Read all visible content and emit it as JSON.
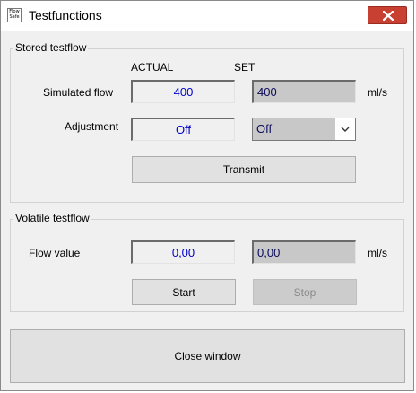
{
  "window": {
    "title": "Testfunctions",
    "icon_text_line1": "Flow",
    "icon_text_line2": "Safe"
  },
  "stored": {
    "legend": "Stored testflow",
    "actual_header": "ACTUAL",
    "set_header": "SET",
    "simulated_flow_label": "Simulated flow",
    "simulated_flow_actual": "400",
    "simulated_flow_set": "400",
    "simulated_flow_unit": "ml/s",
    "adjustment_label": "Adjustment",
    "adjustment_actual": "Off",
    "adjustment_set": "Off",
    "transmit_label": "Transmit"
  },
  "volatile": {
    "legend": "Volatile testflow",
    "flow_value_label": "Flow value",
    "flow_value_actual": "0,00",
    "flow_value_set": "0,00",
    "flow_value_unit": "ml/s",
    "start_label": "Start",
    "stop_label": "Stop"
  },
  "close_window_label": "Close window",
  "colors": {
    "close_button": "#c84031",
    "value_text": "#0000cc",
    "set_field_bg": "#c8c8c8"
  },
  "icons": [
    "app-icon",
    "close-icon",
    "chevron-down-icon"
  ]
}
